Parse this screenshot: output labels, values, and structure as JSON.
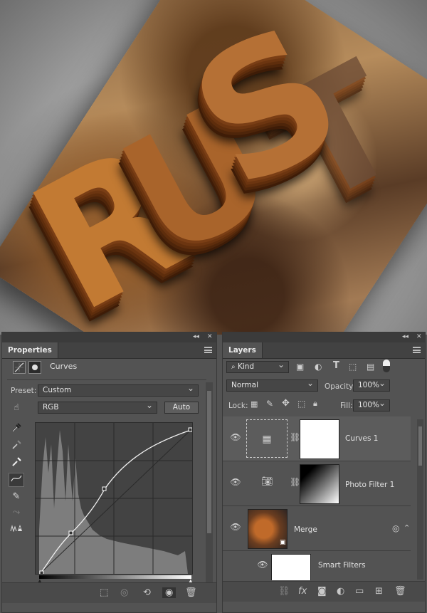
{
  "properties_panel": {
    "tab_title": "Properties",
    "adjustment_name": "Curves",
    "preset_label": "Preset:",
    "preset_value": "Custom",
    "channel_value": "RGB",
    "auto_label": "Auto"
  },
  "layers_panel": {
    "tab_title": "Layers",
    "filter_kind": "Kind",
    "blend_mode": "Normal",
    "opacity_label": "Opacity:",
    "opacity_value": "100%",
    "lock_label": "Lock:",
    "fill_label": "Fill:",
    "fill_value": "100%",
    "layers": [
      {
        "name": "Curves 1"
      },
      {
        "name": "Photo Filter 1"
      },
      {
        "name": "Merge"
      },
      {
        "name": "Smart Filters"
      }
    ]
  },
  "icons": {
    "fx": "fx"
  }
}
